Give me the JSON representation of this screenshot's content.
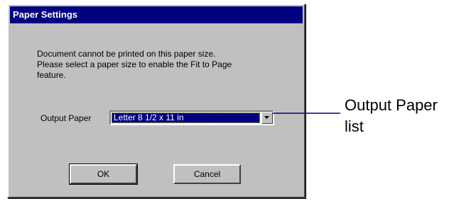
{
  "dialog": {
    "title": "Paper Settings",
    "message": [
      "Document cannot be printed on this paper size.",
      "Please select a paper size to enable the Fit to Page",
      "feature."
    ],
    "output_paper": {
      "label": "Output Paper",
      "selected_value": "Letter 8 1/2 x 11 in"
    },
    "buttons": {
      "ok_label": "OK",
      "cancel_label": "Cancel"
    }
  },
  "callout": {
    "lines": [
      "Output Paper",
      "list"
    ]
  },
  "colors": {
    "titlebar": "#000080",
    "dialog_face": "#c0c0c0",
    "selection": "#000080"
  },
  "icons": {
    "combo_arrow": "chevron-down-icon"
  }
}
